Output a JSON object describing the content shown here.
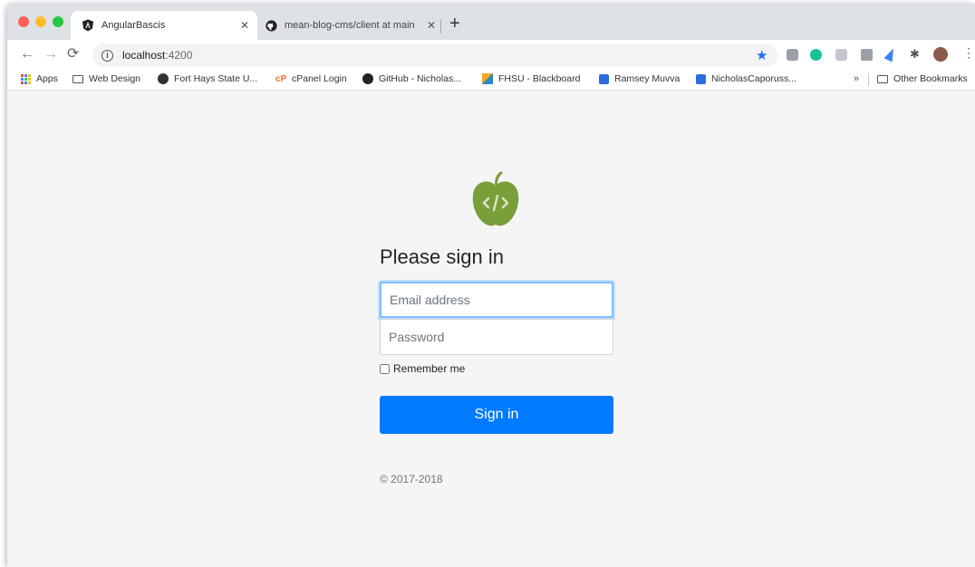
{
  "window": {
    "tabs": [
      {
        "title": "AngularBascis",
        "active": true
      },
      {
        "title": "mean-blog-cms/client at main",
        "active": false
      }
    ],
    "new_tab": "+",
    "close": "✕"
  },
  "toolbar": {
    "url_host": "localhost",
    "url_port": ":4200",
    "info": "i",
    "star": "★",
    "menu": "⋮"
  },
  "bookmarks": {
    "items": [
      {
        "label": "Apps",
        "icon": "apps-grid-icon"
      },
      {
        "label": "Web Design",
        "icon": "folder-icon"
      },
      {
        "label": "Fort Hays State U...",
        "icon": "globe-icon"
      },
      {
        "label": "cPanel Login",
        "icon": "cpanel-icon"
      },
      {
        "label": "GitHub - Nicholas...",
        "icon": "github-icon"
      },
      {
        "label": "FHSU - Blackboard",
        "icon": "blackboard-icon"
      },
      {
        "label": "Ramsey Muvva",
        "icon": "trello-icon"
      },
      {
        "label": "NicholasCaporuss...",
        "icon": "trello-icon"
      }
    ],
    "overflow": "»",
    "other": "Other Bookmarks"
  },
  "signin": {
    "heading": "Please sign in",
    "email_placeholder": "Email address",
    "password_placeholder": "Password",
    "remember_label": "Remember me",
    "button_label": "Sign in",
    "copyright": "© 2017-2018"
  },
  "colors": {
    "primary": "#007bff",
    "logo_green": "#7a9e3a",
    "page_bg": "#f5f5f5"
  }
}
